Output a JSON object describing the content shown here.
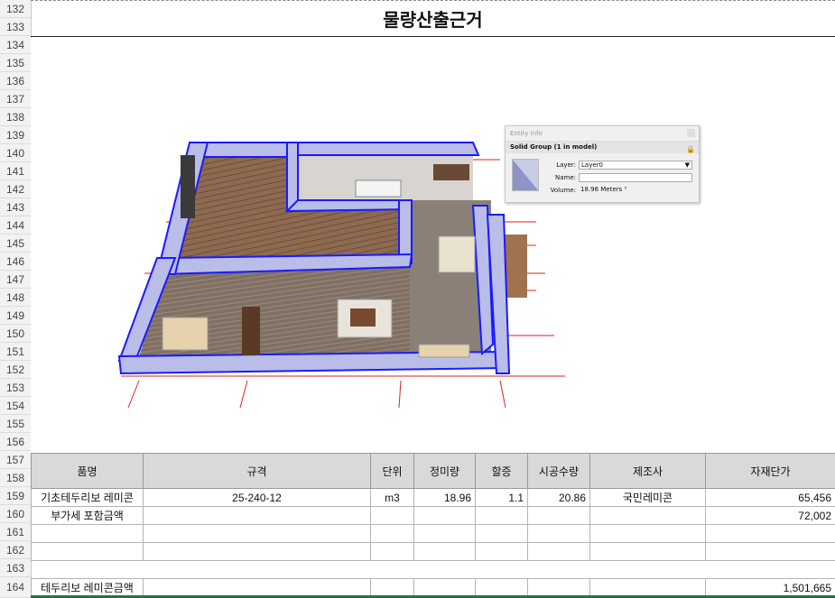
{
  "sheet": {
    "rows": [
      132,
      133,
      134,
      135,
      136,
      137,
      138,
      139,
      140,
      141,
      142,
      143,
      144,
      145,
      146,
      147,
      148,
      149,
      150,
      151,
      152,
      153,
      154,
      155,
      156,
      157,
      158,
      159,
      160,
      161,
      162,
      163,
      164
    ],
    "title": "물량산출근거"
  },
  "entity_info": {
    "window_title": "Entity Info",
    "subtitle": "Solid Group (1 in model)",
    "layer_label": "Layer:",
    "layer_value": "Layer0",
    "name_label": "Name:",
    "name_value": "",
    "volume_label": "Volume:",
    "volume_value": "18.96 Meters ³"
  },
  "table": {
    "headers": [
      "품명",
      "규격",
      "단위",
      "정미량",
      "할증",
      "시공수량",
      "제조사",
      "자재단가"
    ],
    "row159": {
      "name": "기초테두리보 레미콘",
      "spec": "25-240-12",
      "unit": "m3",
      "net": "18.96",
      "surcharge": "1.1",
      "qty": "20.86",
      "maker": "국민레미콘",
      "price": "65,456"
    },
    "row160": {
      "name": "부가세 포함금액",
      "price": "72,002"
    },
    "row164": {
      "name": "테두리보 레미콘금액",
      "price": "1,501,665"
    }
  },
  "colors": {
    "wall_outline": "#1a1aff",
    "wall_fill": "#b9bde8",
    "floor_wood": "#8a6a52",
    "guide_red": "#e02020",
    "header_bg": "#d9d9d9"
  }
}
